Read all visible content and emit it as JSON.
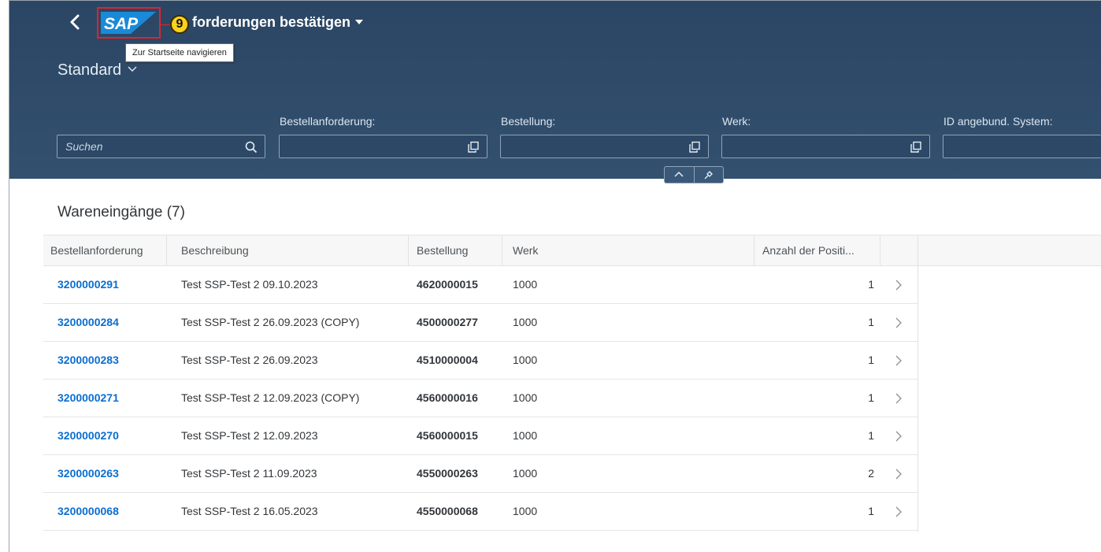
{
  "header": {
    "logo_alt": "SAP",
    "step_number": "9",
    "app_title": "forderungen bestätigen",
    "tooltip": "Zur Startseite navigieren",
    "variant": "Standard"
  },
  "filters": {
    "search_placeholder": "Suchen",
    "fields": [
      {
        "label": "Bestellanforderung:",
        "value": ""
      },
      {
        "label": "Bestellung:",
        "value": ""
      },
      {
        "label": "Werk:",
        "value": ""
      },
      {
        "label": "ID angebund. System:",
        "value": ""
      }
    ]
  },
  "table": {
    "title": "Wareneingänge (7)",
    "columns": [
      "Bestellanforderung",
      "Beschreibung",
      "Bestellung",
      "Werk",
      "Anzahl der Positi..."
    ],
    "rows": [
      {
        "bestellanforderung": "3200000291",
        "beschreibung": "Test SSP-Test 2 09.10.2023",
        "bestellung": "4620000015",
        "werk": "1000",
        "anzahl": "1"
      },
      {
        "bestellanforderung": "3200000284",
        "beschreibung": "Test SSP-Test 2 26.09.2023 (COPY)",
        "bestellung": "4500000277",
        "werk": "1000",
        "anzahl": "1"
      },
      {
        "bestellanforderung": "3200000283",
        "beschreibung": "Test SSP-Test 2 26.09.2023",
        "bestellung": "4510000004",
        "werk": "1000",
        "anzahl": "1"
      },
      {
        "bestellanforderung": "3200000271",
        "beschreibung": "Test SSP-Test 2 12.09.2023 (COPY)",
        "bestellung": "4560000016",
        "werk": "1000",
        "anzahl": "1"
      },
      {
        "bestellanforderung": "3200000270",
        "beschreibung": "Test SSP-Test 2 12.09.2023",
        "bestellung": "4560000015",
        "werk": "1000",
        "anzahl": "1"
      },
      {
        "bestellanforderung": "3200000263",
        "beschreibung": "Test SSP-Test 2 11.09.2023",
        "bestellung": "4550000263",
        "werk": "1000",
        "anzahl": "2"
      },
      {
        "bestellanforderung": "3200000068",
        "beschreibung": "Test SSP-Test 2 16.05.2023",
        "bestellung": "4550000068",
        "werk": "1000",
        "anzahl": "1"
      }
    ]
  },
  "colors": {
    "header_bg": "#2b4664",
    "link": "#0a6ed1",
    "highlight_frame": "#e0232b",
    "step_badge": "#ffd21c"
  },
  "icons": {
    "back": "chevron-left-icon",
    "search": "search-icon",
    "value_help": "value-help-icon",
    "collapse": "chevron-up-icon",
    "pin": "pin-icon",
    "row_nav": "chevron-right-icon"
  }
}
